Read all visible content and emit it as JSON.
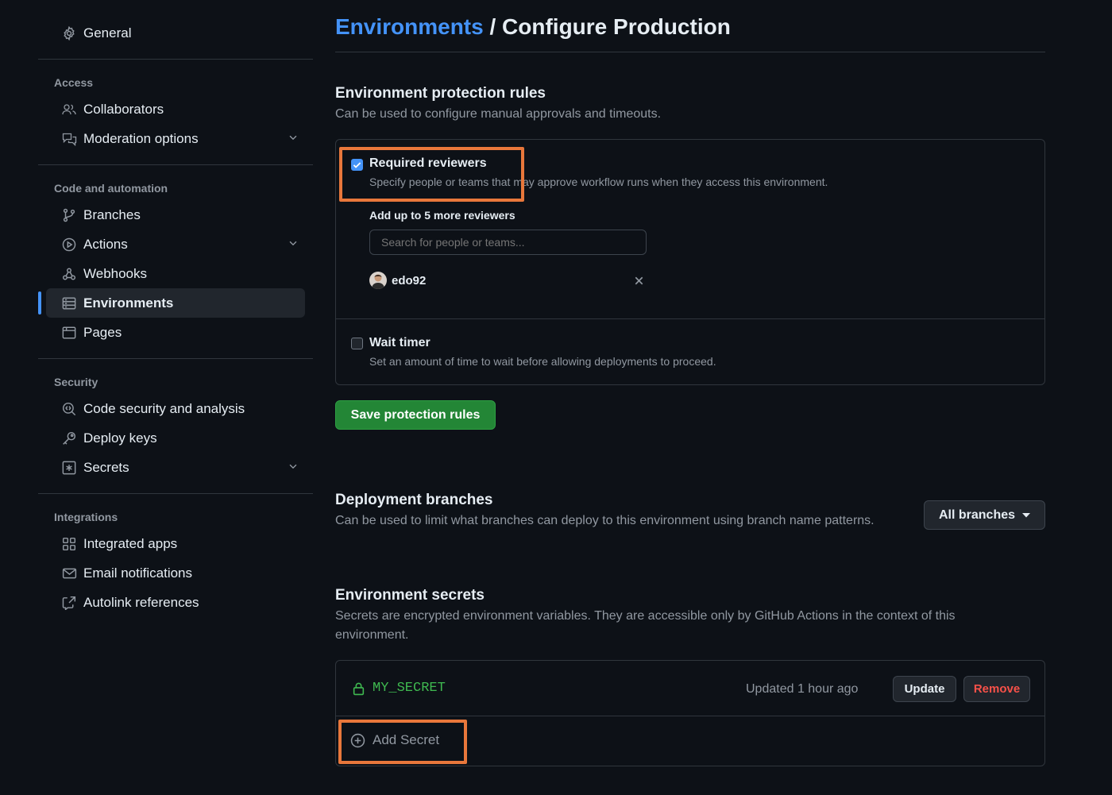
{
  "sidebar": {
    "general": "General",
    "groups": [
      {
        "title": "Access",
        "items": [
          "Collaborators",
          "Moderation options"
        ]
      },
      {
        "title": "Code and automation",
        "items": [
          "Branches",
          "Actions",
          "Webhooks",
          "Environments",
          "Pages"
        ]
      },
      {
        "title": "Security",
        "items": [
          "Code security and analysis",
          "Deploy keys",
          "Secrets"
        ]
      },
      {
        "title": "Integrations",
        "items": [
          "Integrated apps",
          "Email notifications",
          "Autolink references"
        ]
      }
    ],
    "active_item": "Environments"
  },
  "header": {
    "breadcrumb_link": "Environments",
    "separator": "/",
    "title": "Configure Production"
  },
  "protection": {
    "title": "Environment protection rules",
    "description": "Can be used to configure manual approvals and timeouts.",
    "required_reviewers": {
      "label": "Required reviewers",
      "checked": true,
      "description": "Specify people or teams that may approve workflow runs when they access this environment.",
      "add_label": "Add up to 5 more reviewers",
      "search_placeholder": "Search for people or teams...",
      "reviewer": "edo92"
    },
    "wait_timer": {
      "label": "Wait timer",
      "checked": false,
      "description": "Set an amount of time to wait before allowing deployments to proceed."
    },
    "save_label": "Save protection rules"
  },
  "deployment_branches": {
    "title": "Deployment branches",
    "description": "Can be used to limit what branches can deploy to this environment using branch name patterns.",
    "dropdown_value": "All branches"
  },
  "secrets": {
    "title": "Environment secrets",
    "description_line1": "Secrets are encrypted environment variables. They are accessible only by GitHub Actions in the context of this",
    "description_line2": "environment.",
    "items": [
      {
        "name": "MY_SECRET",
        "updated": "Updated 1 hour ago",
        "update_label": "Update",
        "remove_label": "Remove"
      }
    ],
    "add_label": "Add Secret"
  },
  "colors": {
    "background": "#0d1117",
    "accent_blue": "#4493f8",
    "primary_green": "#238636",
    "danger_red": "#f85149",
    "highlight_orange": "#e8773b",
    "secret_name_green": "#3fb950"
  }
}
